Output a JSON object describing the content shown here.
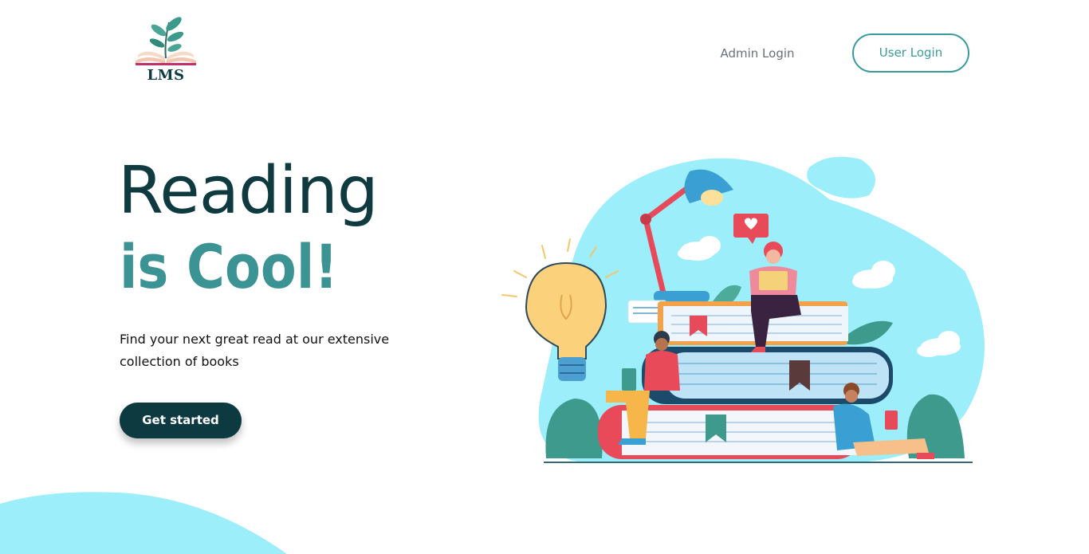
{
  "brand": {
    "logo_text": "LMS"
  },
  "nav": {
    "admin_login": "Admin Login",
    "user_login": "User Login"
  },
  "hero": {
    "title_line1": "Reading",
    "title_line2": "is Cool!",
    "description": "Find your next great read at our extensive collection of books",
    "cta_label": "Get started"
  },
  "colors": {
    "primary": "#0d3a40",
    "accent": "#3b9a9c",
    "blob": "#9beefa"
  }
}
